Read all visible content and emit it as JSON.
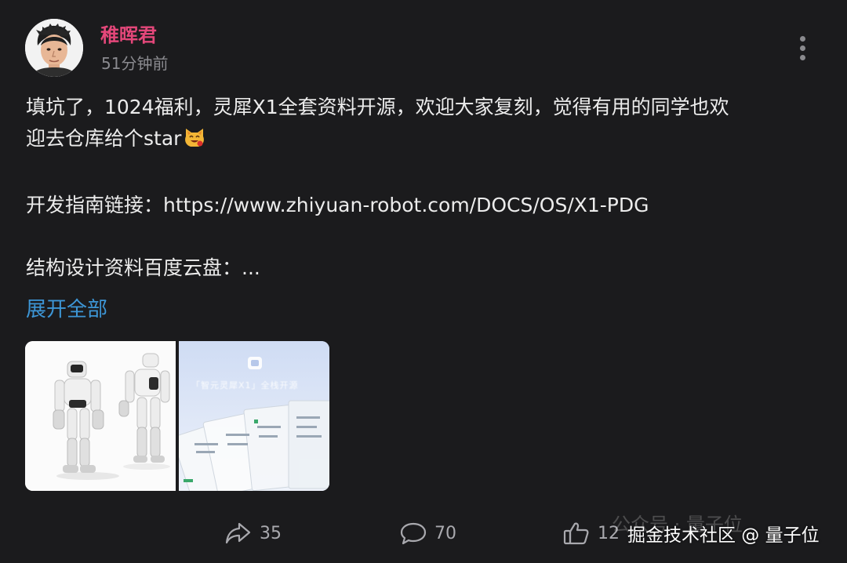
{
  "author": {
    "name": "稚晖君",
    "time": "51分钟前"
  },
  "post": {
    "lines": [
      "填坑了，1024福利，灵犀X1全套资料开源，欢迎大家复刻，觉得有用的同学也欢",
      "迎去仓库给个star",
      "",
      "开发指南链接：https://www.zhiyuan-robot.com/DOCS/OS/X1-PDG",
      "",
      "结构设计资料百度云盘：..."
    ],
    "expand_label": "展开全部"
  },
  "images": {
    "docs_caption": "「智元灵犀X1」全栈开源"
  },
  "actions": {
    "share_count": "35",
    "comment_count": "70",
    "like_count": "12"
  },
  "watermark": {
    "faded": "公众号 · 量子位",
    "main": "掘金技术社区 @ 量子位"
  },
  "icons": {
    "share": "share-arrow-icon",
    "comment": "speech-bubble-icon",
    "like": "thumbs-up-icon",
    "more": "vertical-dots-icon",
    "emoji": "grinning-cat-emoji"
  },
  "colors": {
    "background": "#1b1b1d",
    "author_name": "#e4477a",
    "link": "#3d96d6",
    "muted": "#8b8b90"
  }
}
